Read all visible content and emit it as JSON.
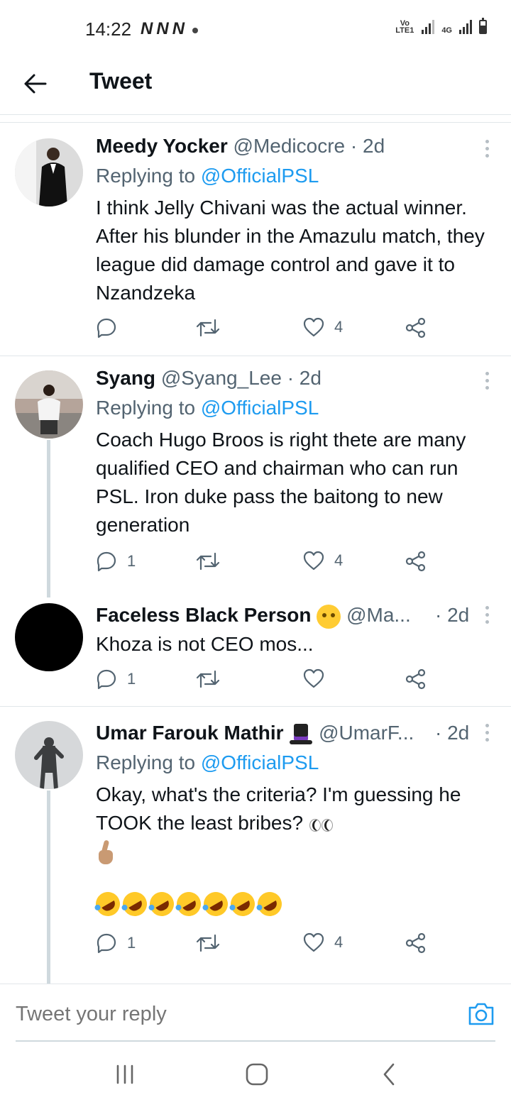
{
  "status_bar": {
    "time": "14:22",
    "notifications": [
      "N",
      "N",
      "N"
    ],
    "network_1": "Vo LTE1",
    "network_2": "4G"
  },
  "header": {
    "title": "Tweet"
  },
  "tweets": [
    {
      "name": "Meedy Yocker",
      "handle": "@Medicocre",
      "time": "· 2d",
      "replying_prefix": "Replying to",
      "replying_to": "@OfficialPSL",
      "text": "I think Jelly Chivani was the actual winner. After his blunder in the Amazulu match, they league did damage control and gave it to Nzandzeka",
      "replies": "",
      "retweets": "",
      "likes": "4"
    },
    {
      "name": "Syang",
      "handle": "@Syang_Lee",
      "time": "· 2d",
      "replying_prefix": "Replying to",
      "replying_to": "@OfficialPSL",
      "text": "Coach Hugo Broos is right thete are many qualified CEO and chairman who can run PSL. Iron duke pass the baitong to new generation",
      "replies": "1",
      "retweets": "",
      "likes": "4"
    },
    {
      "name": "Faceless Black Person",
      "handle": "@Ma...",
      "time": "· 2d",
      "text": "Khoza is not CEO mos...",
      "replies": "1",
      "retweets": "",
      "likes": ""
    },
    {
      "name": "Umar Farouk Mathir",
      "handle": "@UmarF...",
      "time": "· 2d",
      "replying_prefix": "Replying to",
      "replying_to": "@OfficialPSL",
      "text_line1": "Okay, what's the criteria? I'm guessing he TOOK the least bribes?",
      "replies": "1",
      "retweets": "",
      "likes": "4"
    }
  ],
  "reply_bar": {
    "placeholder": "Tweet your reply"
  },
  "colors": {
    "link": "#1d9bf0",
    "secondary": "#536471",
    "text": "#0f1419",
    "divider": "#e1e6ea"
  }
}
